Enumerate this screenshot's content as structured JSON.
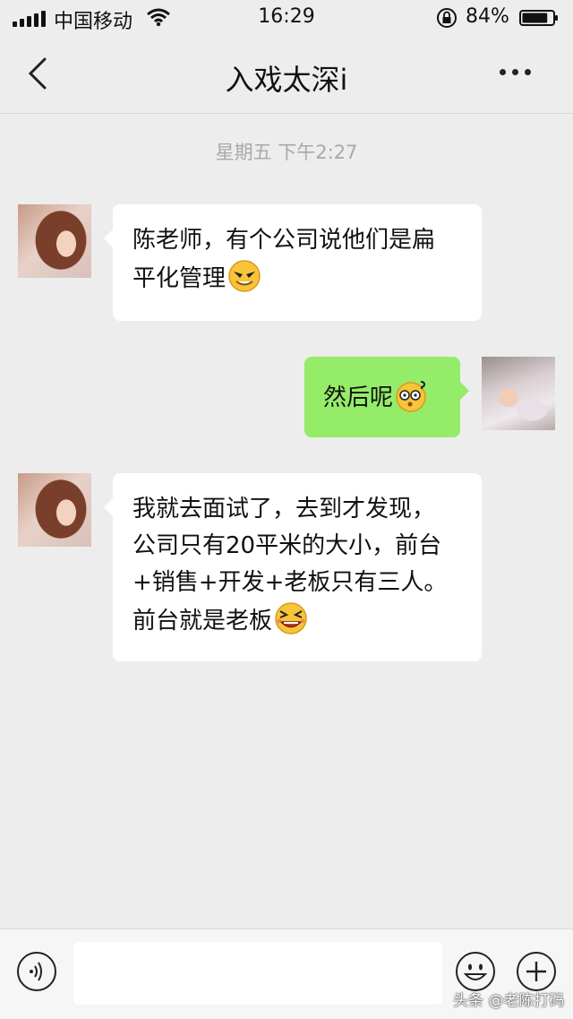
{
  "status_bar": {
    "carrier": "中国移动",
    "time": "16:29",
    "battery_percent": "84%",
    "battery_level": 0.84
  },
  "nav": {
    "title": "入戏太深i"
  },
  "chat": {
    "timestamp": "星期五 下午2:27",
    "messages": [
      {
        "side": "left",
        "line1": "陈老师，有个公司说他们是扁",
        "line2": "平化管理",
        "emoji": "cool-grin-emoji"
      },
      {
        "side": "right",
        "text": "然后呢",
        "emoji": "dizzy-confused-emoji"
      },
      {
        "side": "left",
        "line1": "我就去面试了，去到才发现，",
        "line2": "公司只有20平米的大小，前台",
        "line3": "+销售+开发+老板只有三人。",
        "line4": "前台就是老板",
        "emoji": "laughing-squint-emoji"
      }
    ]
  },
  "input_bar": {
    "placeholder": ""
  },
  "watermark": "头条 @老陈打码"
}
